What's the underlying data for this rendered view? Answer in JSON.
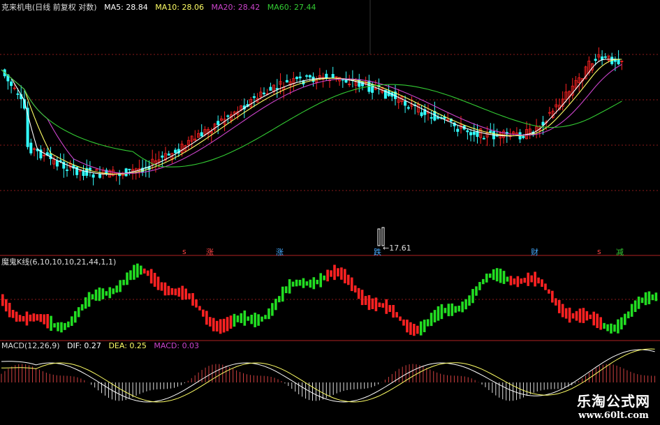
{
  "price_panel": {
    "title": "克来机电(日线 前复权 对数)",
    "ma": [
      {
        "label": "MA5: 28.84",
        "color": "#ffffff"
      },
      {
        "label": "MA10: 28.06",
        "color": "#ffff66"
      },
      {
        "label": "MA20: 28.42",
        "color": "#cc44cc"
      },
      {
        "label": "MA60: 27.44",
        "color": "#33cc33"
      }
    ]
  },
  "markers": [
    {
      "text": "涨",
      "color": "#ff4444"
    },
    {
      "text": "涨",
      "color": "#44aaff"
    },
    {
      "text": "跌",
      "color": "#44aaff"
    },
    {
      "text": "←17.61",
      "color": "#dddddd"
    },
    {
      "text": "财",
      "color": "#44aaff"
    },
    {
      "text": "减",
      "color": "#33cc33"
    }
  ],
  "indicator_panel": {
    "title": "魔鬼K线(6,10,10,10,21,44,1,1)"
  },
  "macd_panel": {
    "title": "MACD(12,26,9)",
    "items": [
      {
        "label": "DIF: 0.27",
        "color": "#ffffff"
      },
      {
        "label": "DEA: 0.25",
        "color": "#ffff66"
      },
      {
        "label": "MACD: 0.03",
        "color": "#cc44cc"
      }
    ]
  },
  "watermark": {
    "cn": "乐淘公式网",
    "en": "www.60lt.com"
  },
  "colors": {
    "up": "#ff2222",
    "down": "#33ffff",
    "green": "#33cc33",
    "grid": "#8b1a1a"
  }
}
